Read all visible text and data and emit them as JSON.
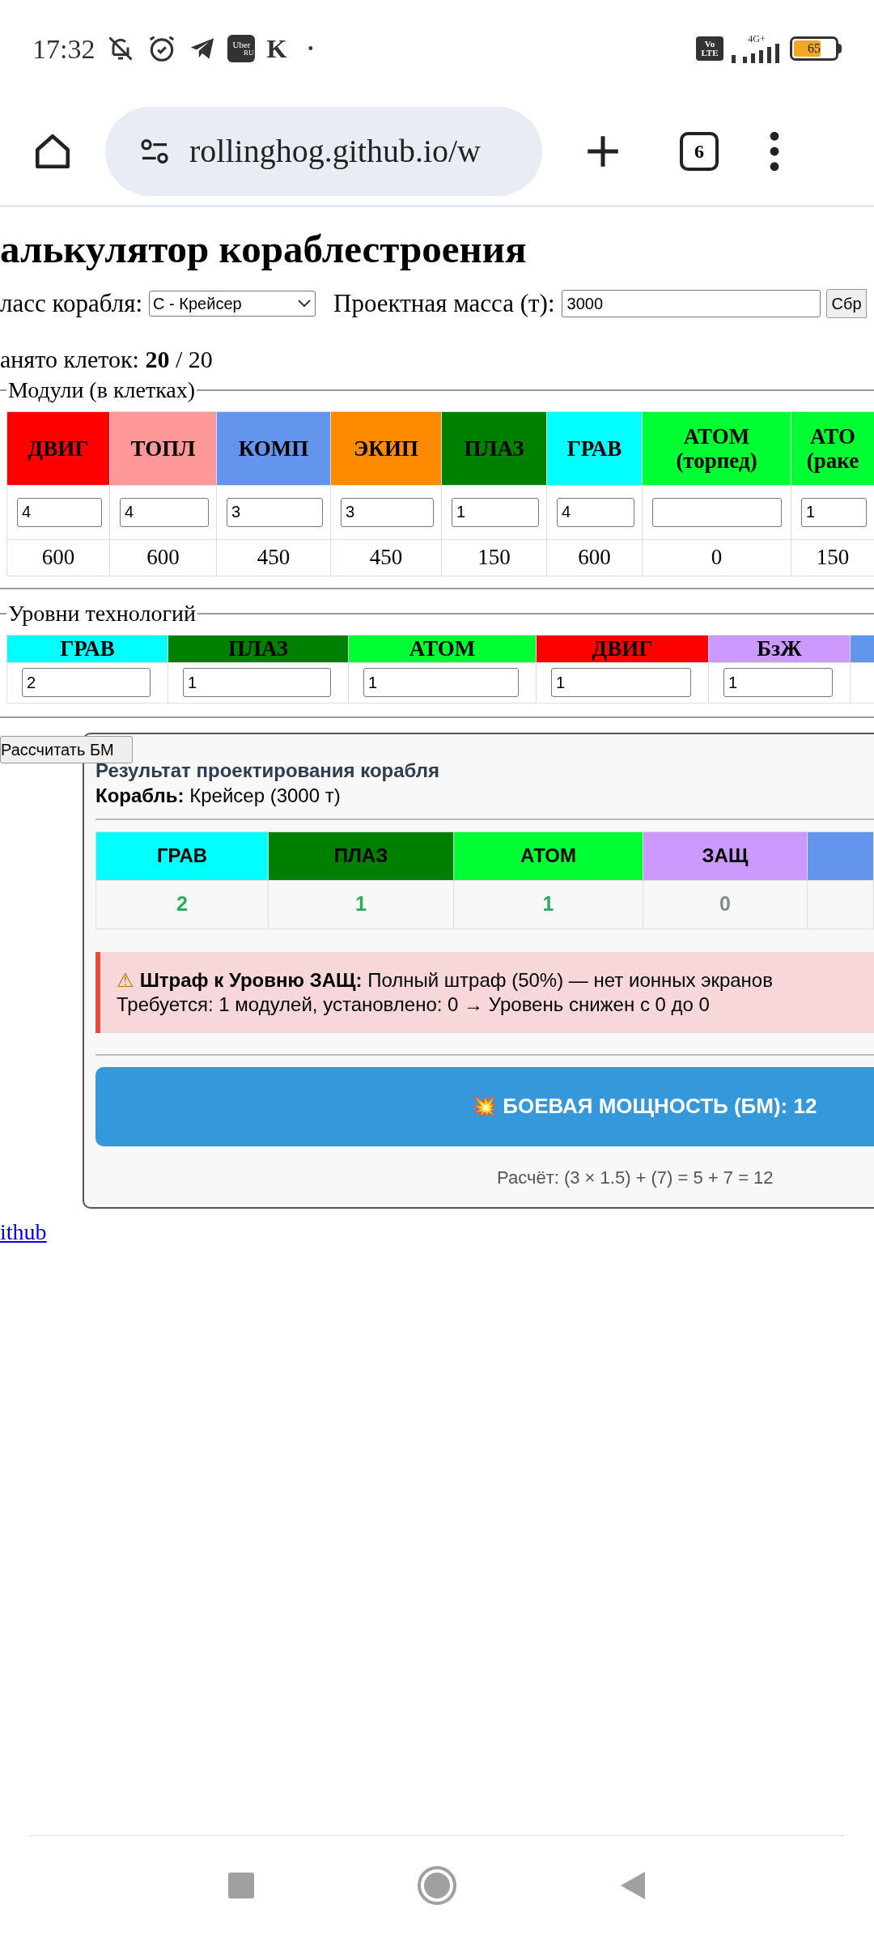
{
  "status_bar": {
    "time": "17:32",
    "uber_label": "Uber",
    "uber_region": "RU",
    "k_label": "K",
    "dot": "•",
    "volte": [
      "Vo",
      "LTE"
    ],
    "network": "4G+",
    "battery": "65"
  },
  "browser": {
    "url": "rollinghog.github.io/w",
    "tab_count": "6"
  },
  "page": {
    "title": "алькулятор кораблестроения",
    "ship_class_label": "ласс корабля:",
    "ship_class_value": "С - Крейсер",
    "mass_label": "Проектная масса (т):",
    "mass_value": "3000",
    "reset_button": "Сбр",
    "cells_label": "анято клеток:",
    "cells_used": "20",
    "cells_total": "/ 20",
    "modules_legend": "Модули (в клетках)",
    "modules": [
      {
        "header": [
          "ДВИГ"
        ],
        "color": "#ff0000",
        "value": "4",
        "mass": "600"
      },
      {
        "header": [
          "ТОПЛ"
        ],
        "color": "#ff9999",
        "value": "4",
        "mass": "600"
      },
      {
        "header": [
          "КОМП"
        ],
        "color": "#6495ed",
        "value": "3",
        "mass": "450"
      },
      {
        "header": [
          "ЭКИП"
        ],
        "color": "#ff8c00",
        "value": "3",
        "mass": "450"
      },
      {
        "header": [
          "ПЛАЗ"
        ],
        "color": "#008000",
        "value": "1",
        "mass": "150"
      },
      {
        "header": [
          "ГРАВ"
        ],
        "color": "#00ffff",
        "value": "4",
        "mass": "600"
      },
      {
        "header": [
          "АТОМ",
          "(торпед)"
        ],
        "color": "#00ff33",
        "mass": "0"
      },
      {
        "header": [
          "АТО",
          "(раке"
        ],
        "color": "#00ff33",
        "value": "1",
        "mass": "150"
      }
    ],
    "tech_legend": "Уровни технологий",
    "tech": [
      {
        "header": "ГРАВ",
        "color": "#00ffff",
        "value": "2"
      },
      {
        "header": "ПЛАЗ",
        "color": "#008000",
        "value": "1"
      },
      {
        "header": "АТОМ",
        "color": "#00ff33",
        "value": "1"
      },
      {
        "header": "ДВИГ",
        "color": "#ff0000",
        "value": "1"
      },
      {
        "header": "БзЖ",
        "color": "#cc99ff",
        "value": "1"
      },
      {
        "color": "#6495ed"
      }
    ],
    "calc_button": "Рассчитать БМ",
    "result": {
      "title": "Результат проектирования корабля",
      "ship_label": "Корабль:",
      "ship_value": "Крейсер (3000 т)",
      "levels": [
        {
          "header": "ГРАВ",
          "color": "#00ffff",
          "value": "2",
          "positive": true
        },
        {
          "header": "ПЛАЗ",
          "color": "#008000",
          "value": "1",
          "positive": true
        },
        {
          "header": "АТОМ",
          "color": "#00ff33",
          "value": "1",
          "positive": true
        },
        {
          "header": "ЗАЩ",
          "color": "#cc99ff",
          "value": "0",
          "positive": false
        },
        {
          "color": "#6495ed"
        }
      ],
      "warning": {
        "icon": "⚠",
        "title": "Штраф к Уровню ЗАЩ:",
        "text": "Полный штраф (50%) — нет ионных экранов",
        "detail": "Требуется: 1 модулей, установлено: 0 → Уровень снижен с 0 до 0"
      },
      "power": {
        "icon": "💥",
        "text": "БОЕВАЯ МОЩНОСТЬ (БМ): 12"
      },
      "formula": "Расчёт: (3 × 1.5) + (7) = 5 + 7 = 12"
    },
    "link": "ithub"
  }
}
